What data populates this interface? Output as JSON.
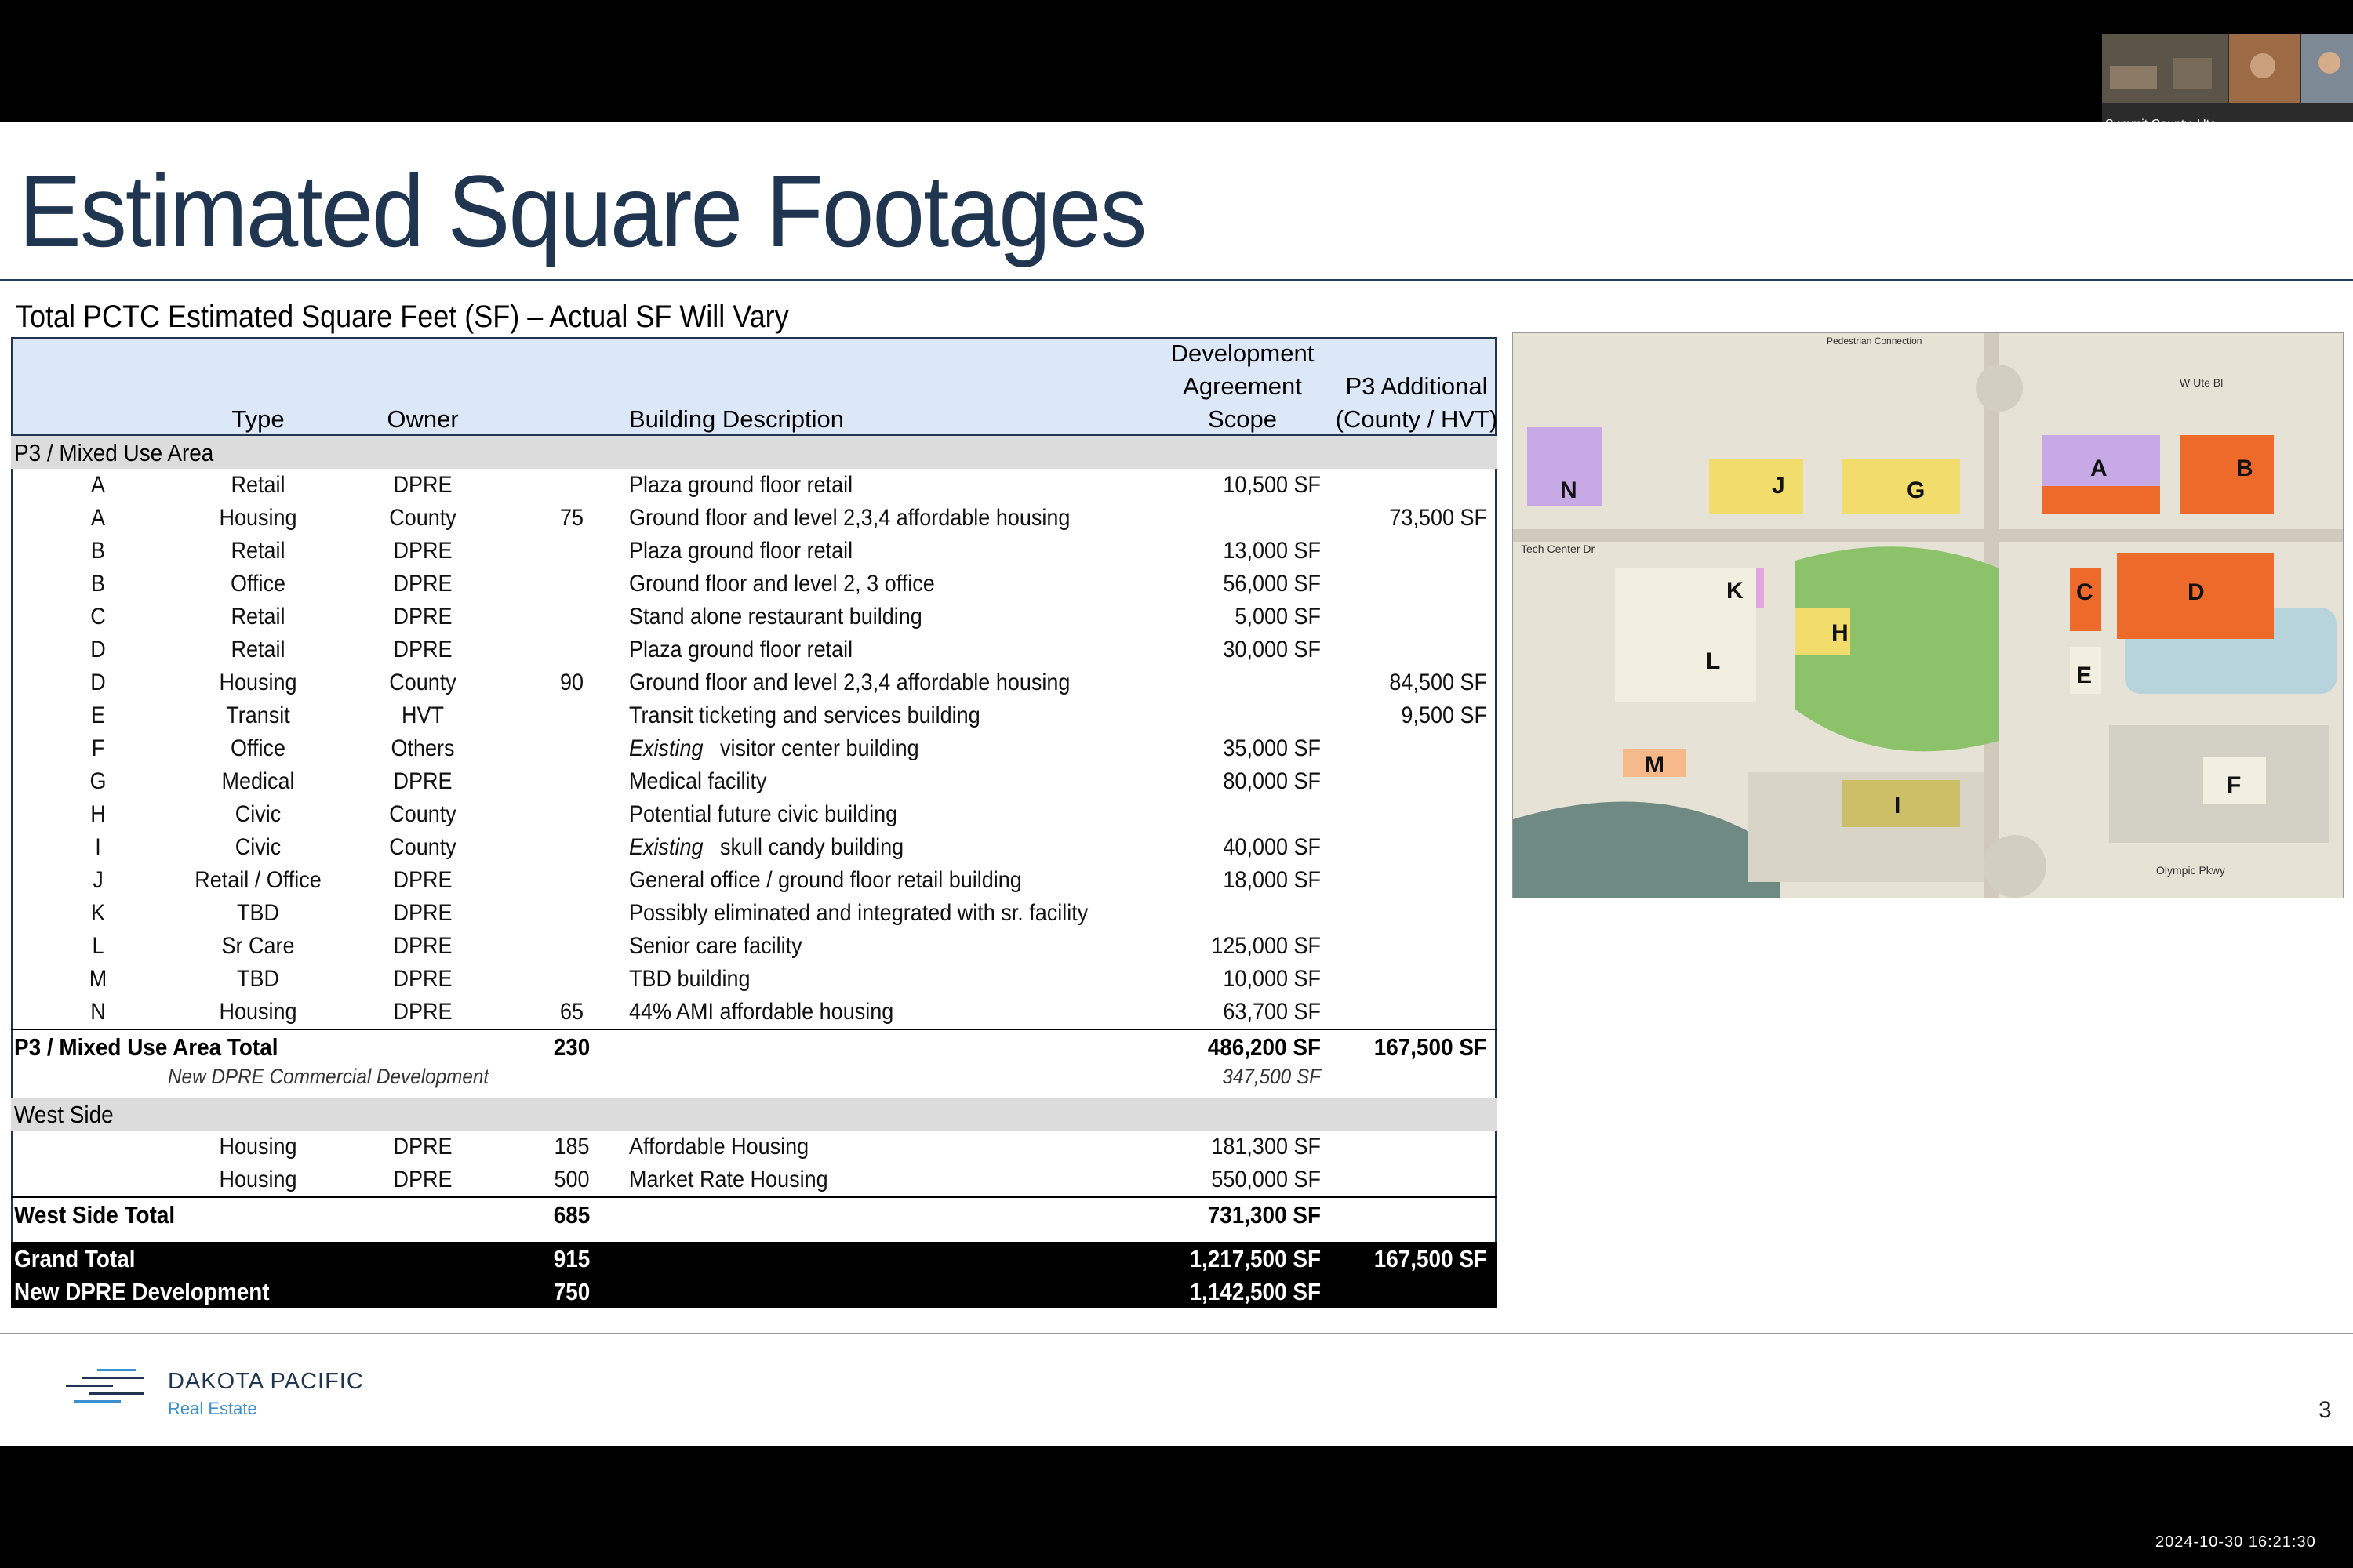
{
  "title": "Estimated Square Footages",
  "subtitle": "Total PCTC Estimated Square Feet (SF) – Actual SF Will Vary",
  "table": {
    "headers": {
      "type": "Type",
      "owner": "Owner",
      "description": "Building Description",
      "dev_line1": "Development",
      "dev_line2": "Agreement",
      "dev_line3": "Scope",
      "p3_line1": "P3 Additional",
      "p3_line2": "(County / HVT)"
    },
    "p3_section": "P3 / Mixed Use Area",
    "p3_rows": [
      {
        "id": "A",
        "type": "Retail",
        "owner": "DPRE",
        "units": "",
        "desc_prefix": "",
        "desc": "Plaza ground floor retail",
        "dev": "10,500 SF",
        "p3": ""
      },
      {
        "id": "A",
        "type": "Housing",
        "owner": "County",
        "units": "75",
        "desc_prefix": "",
        "desc": "Ground floor and level 2,3,4 affordable housing",
        "dev": "",
        "p3": "73,500 SF"
      },
      {
        "id": "B",
        "type": "Retail",
        "owner": "DPRE",
        "units": "",
        "desc_prefix": "",
        "desc": "Plaza ground floor retail",
        "dev": "13,000 SF",
        "p3": ""
      },
      {
        "id": "B",
        "type": "Office",
        "owner": "DPRE",
        "units": "",
        "desc_prefix": "",
        "desc": "Ground floor and level 2, 3 office",
        "dev": "56,000 SF",
        "p3": ""
      },
      {
        "id": "C",
        "type": "Retail",
        "owner": "DPRE",
        "units": "",
        "desc_prefix": "",
        "desc": "Stand alone restaurant building",
        "dev": "5,000 SF",
        "p3": ""
      },
      {
        "id": "D",
        "type": "Retail",
        "owner": "DPRE",
        "units": "",
        "desc_prefix": "",
        "desc": "Plaza ground floor retail",
        "dev": "30,000 SF",
        "p3": ""
      },
      {
        "id": "D",
        "type": "Housing",
        "owner": "County",
        "units": "90",
        "desc_prefix": "",
        "desc": "Ground floor and level 2,3,4 affordable housing",
        "dev": "",
        "p3": "84,500 SF"
      },
      {
        "id": "E",
        "type": "Transit",
        "owner": "HVT",
        "units": "",
        "desc_prefix": "",
        "desc": "Transit ticketing and services building",
        "dev": "",
        "p3": "9,500 SF"
      },
      {
        "id": "F",
        "type": "Office",
        "owner": "Others",
        "units": "",
        "desc_prefix": "Existing",
        "desc": "visitor center building",
        "dev": "35,000 SF",
        "p3": ""
      },
      {
        "id": "G",
        "type": "Medical",
        "owner": "DPRE",
        "units": "",
        "desc_prefix": "",
        "desc": "Medical facility",
        "dev": "80,000 SF",
        "p3": ""
      },
      {
        "id": "H",
        "type": "Civic",
        "owner": "County",
        "units": "",
        "desc_prefix": "",
        "desc": "Potential future civic building",
        "dev": "",
        "p3": ""
      },
      {
        "id": "I",
        "type": "Civic",
        "owner": "County",
        "units": "",
        "desc_prefix": "Existing",
        "desc": "skull candy building",
        "dev": "40,000 SF",
        "p3": ""
      },
      {
        "id": "J",
        "type": "Retail / Office",
        "owner": "DPRE",
        "units": "",
        "desc_prefix": "",
        "desc": "General office / ground floor retail building",
        "dev": "18,000 SF",
        "p3": ""
      },
      {
        "id": "K",
        "type": "TBD",
        "owner": "DPRE",
        "units": "",
        "desc_prefix": "",
        "desc": "Possibly eliminated and integrated with sr. facility",
        "dev": "",
        "p3": ""
      },
      {
        "id": "L",
        "type": "Sr Care",
        "owner": "DPRE",
        "units": "",
        "desc_prefix": "",
        "desc": "Senior care facility",
        "dev": "125,000 SF",
        "p3": ""
      },
      {
        "id": "M",
        "type": "TBD",
        "owner": "DPRE",
        "units": "",
        "desc_prefix": "",
        "desc": "TBD building",
        "dev": "10,000 SF",
        "p3": ""
      },
      {
        "id": "N",
        "type": "Housing",
        "owner": "DPRE",
        "units": "65",
        "desc_prefix": "",
        "desc": "44% AMI affordable housing",
        "dev": "63,700 SF",
        "p3": ""
      }
    ],
    "p3_total": {
      "label": "P3 / Mixed Use Area Total",
      "units": "230",
      "dev": "486,200 SF",
      "p3": "167,500 SF"
    },
    "p3_note": {
      "label": "New DPRE Commercial Development",
      "dev": "347,500 SF"
    },
    "west_section": "West Side",
    "west_rows": [
      {
        "type": "Housing",
        "owner": "DPRE",
        "units": "185",
        "desc": "Affordable Housing",
        "dev": "181,300 SF"
      },
      {
        "type": "Housing",
        "owner": "DPRE",
        "units": "500",
        "desc": "Market Rate Housing",
        "dev": "550,000 SF"
      }
    ],
    "west_total": {
      "label": "West Side Total",
      "units": "685",
      "dev": "731,300 SF"
    },
    "grand_total": {
      "label": "Grand Total",
      "units": "915",
      "dev": "1,217,500 SF",
      "p3": "167,500 SF"
    },
    "new_dpre": {
      "label": "New DPRE Development",
      "units": "750",
      "dev": "1,142,500 SF"
    }
  },
  "map": {
    "labels": [
      "N",
      "J",
      "G",
      "A",
      "B",
      "K",
      "C",
      "D",
      "H",
      "L",
      "E",
      "M",
      "I",
      "F"
    ],
    "street_labels": [
      "W Ute Bl",
      "Tech Center Dr",
      "Olympic Pkwy",
      "Pedestrian Connection"
    ],
    "colors": {
      "retail": "#f2dc6b",
      "office": "#b89be0",
      "housing": "#ee6a2a",
      "green": "#8cc36a"
    }
  },
  "footer": {
    "logo_name": "DAKOTA PACIFIC",
    "logo_sub": "Real Estate",
    "page_number": "3"
  },
  "video": {
    "label": "Summit County, Uta..."
  },
  "timestamp": "2024-10-30  16:21:30"
}
